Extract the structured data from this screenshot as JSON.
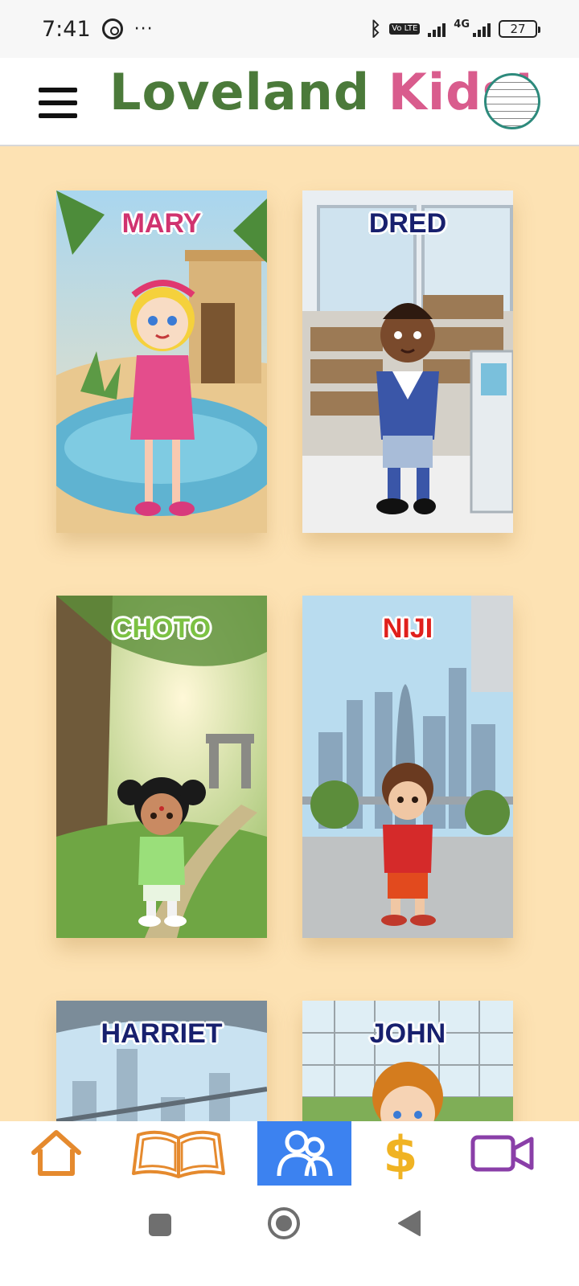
{
  "status_bar": {
    "time": "7:41",
    "icons": [
      "whatsapp-icon",
      "more-dots-icon",
      "bluetooth-icon",
      "volte-icon",
      "signal-icon",
      "4g-signal-icon"
    ],
    "volte_label": "Vo LTE",
    "network_label": "4G",
    "battery": "27"
  },
  "header": {
    "title_part1": "Loveland",
    "title_part2": "Kids!",
    "colors": {
      "green": "#4b7a3a",
      "pink": "#d95c8d",
      "profile_ring": "#2d8a7c"
    }
  },
  "kids": [
    {
      "name": "MARY",
      "name_color": "#d0336f",
      "scene": "desert-oasis"
    },
    {
      "name": "DRED",
      "name_color": "#18206e",
      "scene": "library"
    },
    {
      "name": "CHOTO",
      "name_color": "#7cc243",
      "scene": "forest"
    },
    {
      "name": "NIJI",
      "name_color": "#e0201c",
      "scene": "city-terrace"
    },
    {
      "name": "HARRIET",
      "name_color": "#18206e",
      "scene": "city-view"
    },
    {
      "name": "JOHN",
      "name_color": "#18206e",
      "scene": "sports-court"
    }
  ],
  "bottom_nav": {
    "items": [
      {
        "name": "home",
        "icon": "home-icon",
        "color": "#e58a2e",
        "active": false
      },
      {
        "name": "stories",
        "icon": "open-book-icon",
        "color": "#e58a2e",
        "active": false
      },
      {
        "name": "kids",
        "icon": "people-icon",
        "color": "#ffffff",
        "active": true
      },
      {
        "name": "shop",
        "icon": "dollar-icon",
        "color": "#f0b323",
        "active": false
      },
      {
        "name": "videos",
        "icon": "video-camera-icon",
        "color": "#8a3fa8",
        "active": false
      }
    ],
    "active_color": "#3c82f0"
  },
  "system_nav": {
    "buttons": [
      "recents-square-icon",
      "home-circle-icon",
      "back-triangle-icon"
    ]
  }
}
